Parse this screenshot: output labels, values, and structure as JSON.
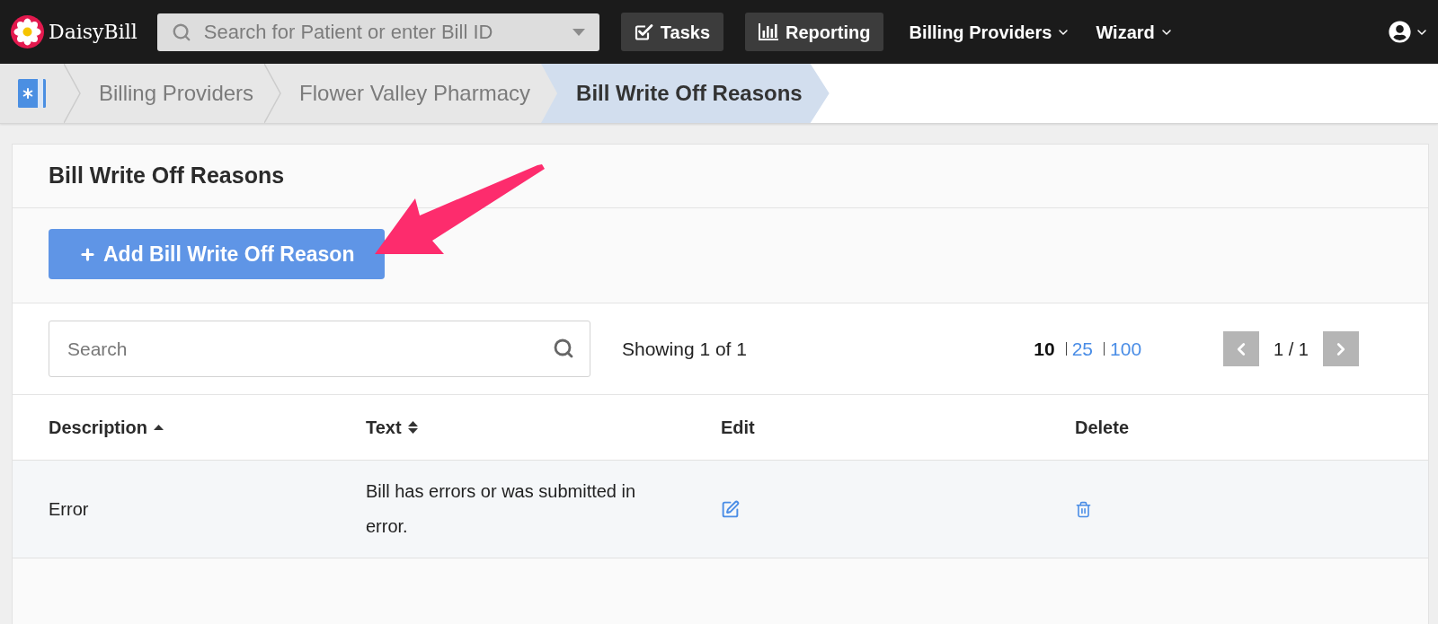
{
  "brand": {
    "name": "DaisyBill"
  },
  "search": {
    "placeholder": "Search for Patient or enter Bill ID"
  },
  "nav": [
    {
      "kind": "button",
      "label": "Tasks"
    },
    {
      "kind": "button",
      "label": "Reporting"
    },
    {
      "kind": "menu",
      "label": "Billing Providers"
    },
    {
      "kind": "menu",
      "label": "Wizard"
    }
  ],
  "breadcrumbs": [
    {
      "label": "Billing Providers",
      "selected": false
    },
    {
      "label": "Flower Valley Pharmacy",
      "selected": false
    },
    {
      "label": "Bill Write Off Reasons",
      "selected": true
    }
  ],
  "panel": {
    "title": "Bill Write Off Reasons",
    "add_button": "Add Bill Write Off Reason"
  },
  "toolbar": {
    "search_placeholder": "Search",
    "summary": "Showing 1 of 1",
    "page_sizes": [
      {
        "label": "10",
        "selected": true
      },
      {
        "label": "25",
        "selected": false
      },
      {
        "label": "100",
        "selected": false
      }
    ],
    "page": "1 / 1"
  },
  "table": {
    "columns": [
      {
        "label": "Description",
        "kind": "sorted"
      },
      {
        "label": "Text",
        "kind": "sortable"
      },
      {
        "label": "Edit",
        "kind": "plain"
      },
      {
        "label": "Delete",
        "kind": "plain"
      }
    ],
    "rows": [
      {
        "description": "Error",
        "text": "Bill has errors or was submitted in error."
      }
    ]
  }
}
